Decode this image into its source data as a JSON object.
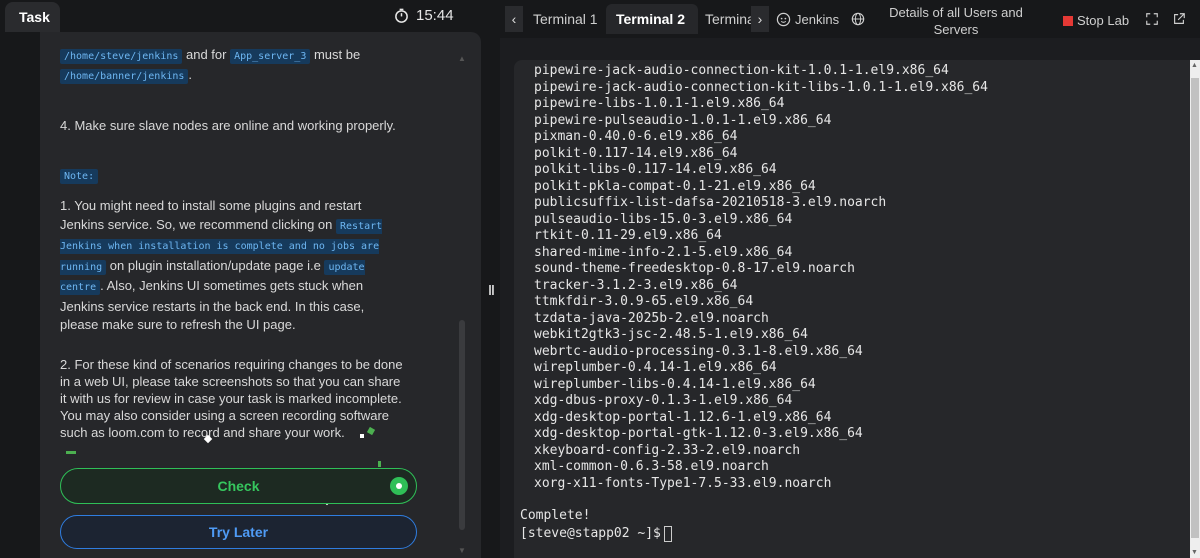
{
  "task": {
    "tab_label": "Task",
    "timer": "15:44",
    "intro_line1_pre": "",
    "path1": "/home/steve/jenkins",
    "intro_mid": " and for ",
    "server3": "App_server_3",
    "intro_end": " must be",
    "path2": "/home/banner/jenkins",
    "intro_period": ".",
    "step4": "4. Make sure slave nodes are online and working properly.",
    "note_label": "Note:",
    "note1_a": "1. You might need to install some plugins and restart Jenkins service. So, we recommend clicking on ",
    "note1_code1": "Restart Jenkins when installation is complete and no jobs are running",
    "note1_b": " on plugin installation/update page i.e ",
    "note1_code2": "update centre",
    "note1_c": ". Also, Jenkins UI sometimes gets stuck when Jenkins service restarts in the back end. In this case, please make sure to refresh the UI page.",
    "note2": "2. For these kind of scenarios requiring changes to be done in a web UI, please take screenshots so that you can share it with us for review in case your task is marked incomplete. You may also consider using a screen recording software such as loom.com to record and share your work.",
    "check_label": "Check",
    "later_label": "Try Later"
  },
  "topbar": {
    "tabs": [
      {
        "label": "Terminal 1",
        "active": false
      },
      {
        "label": "Terminal 2",
        "active": true
      },
      {
        "label": "Terminal",
        "active": false
      }
    ],
    "jenkins_label": "Jenkins",
    "details_label": "Details of all Users and Servers",
    "stop_label": "Stop Lab"
  },
  "terminal": {
    "packages": [
      "pipewire-jack-audio-connection-kit-1.0.1-1.el9.x86_64",
      "pipewire-jack-audio-connection-kit-libs-1.0.1-1.el9.x86_64",
      "pipewire-libs-1.0.1-1.el9.x86_64",
      "pipewire-pulseaudio-1.0.1-1.el9.x86_64",
      "pixman-0.40.0-6.el9.x86_64",
      "polkit-0.117-14.el9.x86_64",
      "polkit-libs-0.117-14.el9.x86_64",
      "polkit-pkla-compat-0.1-21.el9.x86_64",
      "publicsuffix-list-dafsa-20210518-3.el9.noarch",
      "pulseaudio-libs-15.0-3.el9.x86_64",
      "rtkit-0.11-29.el9.x86_64",
      "shared-mime-info-2.1-5.el9.x86_64",
      "sound-theme-freedesktop-0.8-17.el9.noarch",
      "tracker-3.1.2-3.el9.x86_64",
      "ttmkfdir-3.0.9-65.el9.x86_64",
      "tzdata-java-2025b-2.el9.noarch",
      "webkit2gtk3-jsc-2.48.5-1.el9.x86_64",
      "webrtc-audio-processing-0.3.1-8.el9.x86_64",
      "wireplumber-0.4.14-1.el9.x86_64",
      "wireplumber-libs-0.4.14-1.el9.x86_64",
      "xdg-dbus-proxy-0.1.3-1.el9.x86_64",
      "xdg-desktop-portal-1.12.6-1.el9.x86_64",
      "xdg-desktop-portal-gtk-1.12.0-3.el9.x86_64",
      "xkeyboard-config-2.33-2.el9.noarch",
      "xml-common-0.6.3-58.el9.noarch",
      "xorg-x11-fonts-Type1-7.5-33.el9.noarch"
    ],
    "complete": "Complete!",
    "prompt": "[steve@stapp02 ~]$"
  }
}
